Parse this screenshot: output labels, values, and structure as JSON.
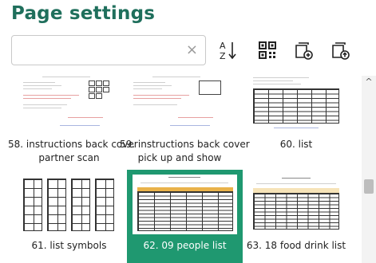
{
  "header": {
    "title": "Page settings"
  },
  "search": {
    "value": "",
    "clear_glyph": "×"
  },
  "toolbar": {
    "sort_icon": "sort-az-icon",
    "grid_icon": "qr-grid-icon",
    "add_page_icon": "add-page-icon",
    "export_page_icon": "export-page-icon"
  },
  "pages": [
    {
      "label": "58. instructions back cover partner scan",
      "line1": "58. instructions back cover",
      "line2": "partner scan",
      "selected": false
    },
    {
      "label": "59. instructions back cover pick up and show",
      "line1": "59. instructions back cover",
      "line2": "pick up and show",
      "selected": false
    },
    {
      "label": "60. list",
      "line1": "60. list",
      "line2": "",
      "selected": false
    },
    {
      "label": "61. list symbols",
      "line1": "61. list symbols",
      "line2": "",
      "selected": false
    },
    {
      "label": "62. 09 people list",
      "line1": "62. 09 people list",
      "line2": "",
      "selected": true
    },
    {
      "label": "63. 18 food drink list",
      "line1": "63. 18 food drink list",
      "line2": "",
      "selected": false
    }
  ],
  "colors": {
    "accent": "#1f6f5c",
    "selection": "#1f9870",
    "table_header": "#e9b24a"
  }
}
